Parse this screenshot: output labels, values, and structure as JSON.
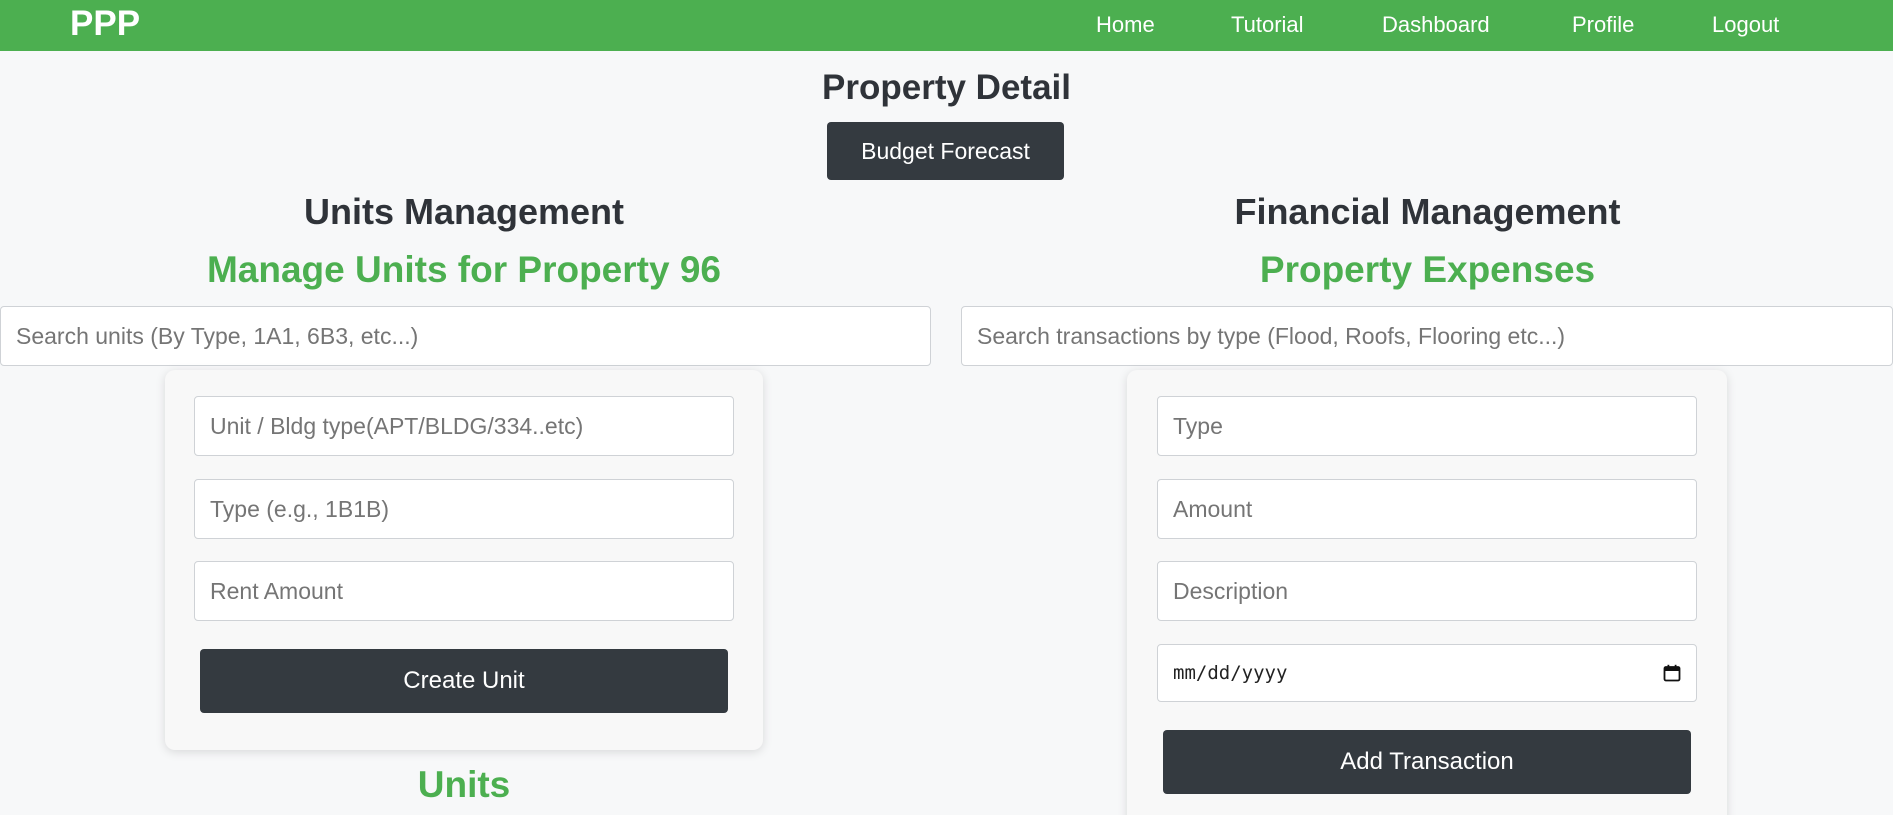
{
  "nav": {
    "brand": "PPP",
    "links": [
      "Home",
      "Tutorial",
      "Dashboard",
      "Profile",
      "Logout"
    ]
  },
  "page": {
    "title": "Property Detail",
    "budget_button": "Budget Forecast"
  },
  "units": {
    "title": "Units Management",
    "subtitle": "Manage Units for Property 96",
    "search_placeholder": "Search units (By Type, 1A1, 6B3, etc...)",
    "form": {
      "unit_placeholder": "Unit / Bldg type(APT/BLDG/334..etc)",
      "type_placeholder": "Type (e.g., 1B1B)",
      "rent_placeholder": "Rent Amount",
      "submit_label": "Create Unit"
    },
    "list_heading": "Units"
  },
  "finance": {
    "title": "Financial Management",
    "subtitle": "Property Expenses",
    "search_placeholder": "Search transactions by type (Flood, Roofs, Flooring etc...)",
    "form": {
      "type_placeholder": "Type",
      "amount_placeholder": "Amount",
      "description_placeholder": "Description",
      "date_placeholder": "mm/dd/yyyy",
      "submit_label": "Add Transaction"
    }
  },
  "colors": {
    "accent": "#4caf50",
    "dark_button": "#343a40",
    "background": "#f7f8f9"
  },
  "icons": {
    "date_picker": "calendar-icon"
  }
}
